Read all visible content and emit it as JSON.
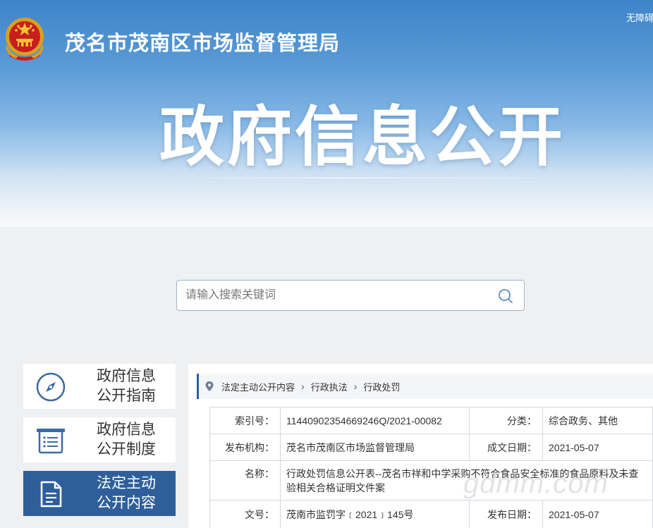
{
  "header": {
    "site_title": "茂名市茂南区市场监督管理局",
    "accessibility_link": "无障碍",
    "hero_title": "政府信息公开"
  },
  "search": {
    "placeholder": "请输入搜索关键词"
  },
  "sidebar": {
    "items": [
      {
        "label": "政府信息公开指南",
        "icon": "compass-icon",
        "active": false
      },
      {
        "label": "政府信息公开制度",
        "icon": "list-document-icon",
        "active": false
      },
      {
        "label": "法定主动公开内容",
        "icon": "document-icon",
        "active": true
      }
    ]
  },
  "breadcrumb": {
    "items": [
      "法定主动公开内容",
      "行政执法",
      "行政处罚"
    ]
  },
  "info": {
    "index_label": "索引号：",
    "index_value": "11440902354669246Q/2021-00082",
    "category_label": "分类：",
    "category_value": "综合政务、其他",
    "publisher_label": "发布机构：",
    "publisher_value": "茂名市茂南区市场监督管理局",
    "created_label": "成文日期：",
    "created_value": "2021-05-07",
    "name_label": "名称：",
    "name_value": "行政处罚信息公开表--茂名市祥和中学采购不符合食品安全标准的食品原料及未查验相关合格证明文件案",
    "docno_label": "文号：",
    "docno_value": "茂南市监罚字﹝2021﹞145号",
    "published_label": "发布日期：",
    "published_value": "2021-05-07"
  },
  "watermark": "gdmm.com",
  "colors": {
    "accent": "#2e5f9a",
    "banner_top": "#3d84c8",
    "page_bg": "#eef0f2"
  }
}
